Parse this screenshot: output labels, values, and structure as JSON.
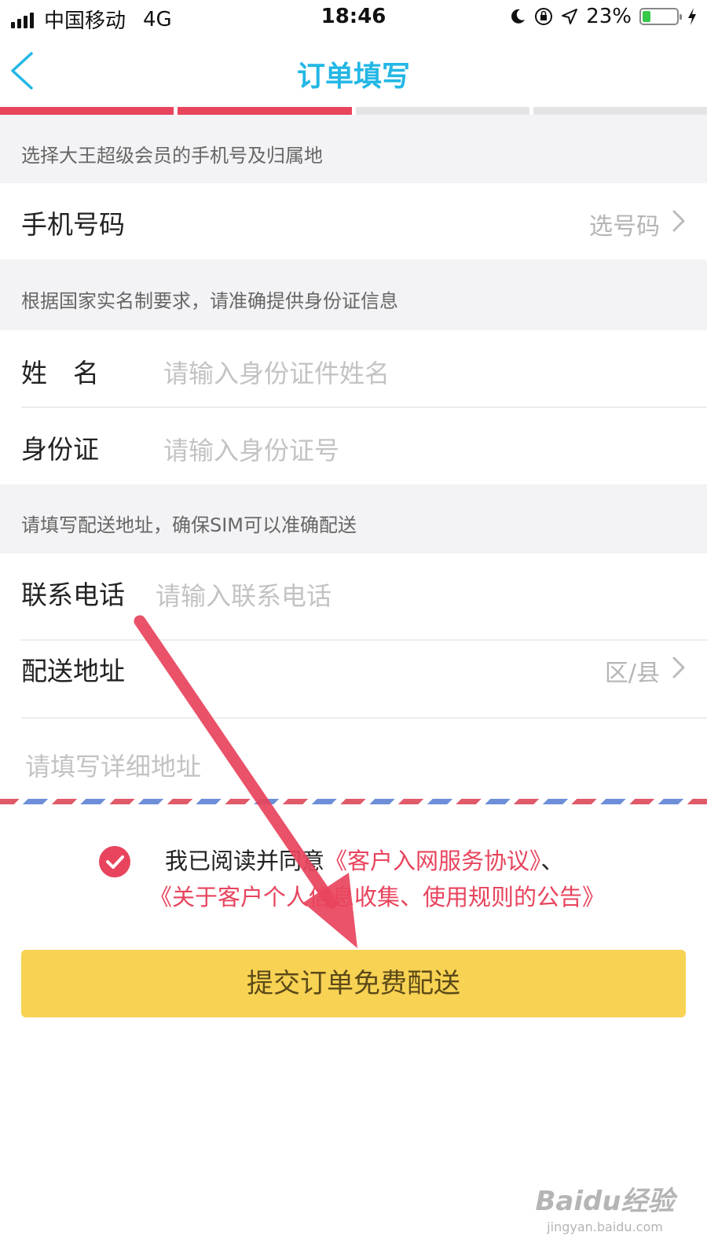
{
  "status_bar": {
    "carrier": "中国移动",
    "network": "4G",
    "time": "18:46",
    "battery": "23%",
    "battery_level": 0.23
  },
  "nav": {
    "title": "订单填写"
  },
  "progress": {
    "steps_total": 4,
    "steps_done": 2,
    "done_color": "#e8445d",
    "todo_color": "#e4e4e6"
  },
  "sections": {
    "phone_hint": "选择大王超级会员的手机号及归属地",
    "id_hint": "根据国家实名制要求，请准确提供身份证信息",
    "address_hint": "请填写配送地址，确保SIM可以准确配送"
  },
  "fields": {
    "phone_number": {
      "label": "手机号码",
      "value": "选号码"
    },
    "name": {
      "label": "姓　名",
      "placeholder": "请输入身份证件姓名"
    },
    "id_card": {
      "label": "身份证",
      "placeholder": "请输入身份证号"
    },
    "contact_phone": {
      "label": "联系电话",
      "placeholder": "请输入联系电话"
    },
    "delivery_address": {
      "label": "配送地址",
      "value": "区/县"
    },
    "detail_address": {
      "placeholder": "请填写详细地址"
    }
  },
  "agreement": {
    "prefix": "我已阅读并同意",
    "link1": "《客户入网服务协议》",
    "separator": "、",
    "link2": "《关于客户个人信息收集、使用规则的公告》"
  },
  "submit": {
    "label": "提交订单免费配送"
  },
  "watermark": {
    "brand": "Baidu经验",
    "url": "jingyan.baidu.com"
  },
  "colors": {
    "accent_blue": "#23b7e5",
    "accent_red": "#e8445d",
    "button_yellow": "#f8d253"
  }
}
